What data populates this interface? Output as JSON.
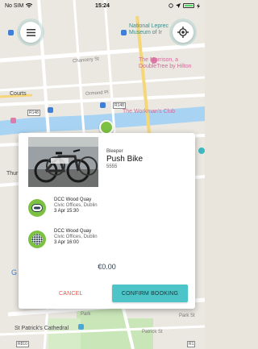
{
  "status_bar": {
    "carrier": "No SIM",
    "time": "15:24"
  },
  "map": {
    "labels": {
      "leprechaun": "National Leprec\nMuseum of Ir",
      "morrison": "The Morrison, a\nDoubleTree by Hilton",
      "workmans": "The Workman's Club",
      "courts": "Courts",
      "chancery": "Chancery St",
      "ormond": "Ormond Pl",
      "thurs": "Thur",
      "park": "Park",
      "cathedral": "St Patrick's Cathedral",
      "patrick_st": "Patrick St",
      "park_st": "Park St",
      "road_r148": "R148",
      "road_r810": "R810",
      "road_r1": "R1",
      "g": "G"
    }
  },
  "booking": {
    "bike_type": "Bleeper",
    "bike_name": "Push Bike",
    "bike_id": "5555",
    "pickup": {
      "title": "DCC Wood Quay",
      "address": "Civic Offices, Dublin",
      "time": "3 Apr 15:30"
    },
    "dropoff": {
      "title": "DCC Wood Quay",
      "address": "Civic Offices, Dublin",
      "time": "3 Apr 16:00"
    },
    "price": "€0.00",
    "cancel_label": "CANCEL",
    "confirm_label": "CONFIRM BOOKING"
  }
}
